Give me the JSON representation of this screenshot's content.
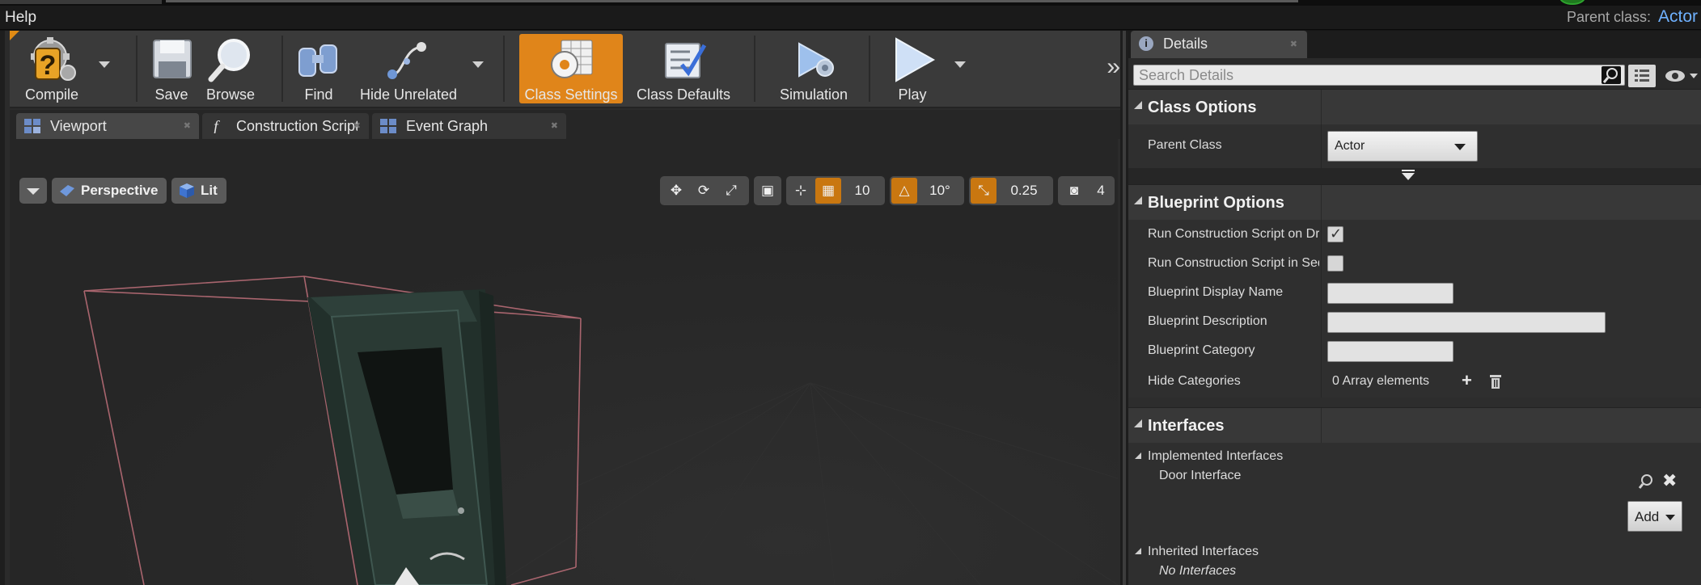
{
  "menubar": {
    "help": "Help",
    "parent_class_label": "Parent class:",
    "parent_class_value": "Actor"
  },
  "toolbar": {
    "compile": "Compile",
    "save": "Save",
    "browse": "Browse",
    "find": "Find",
    "hide_unrelated": "Hide Unrelated",
    "class_settings": "Class Settings",
    "class_defaults": "Class Defaults",
    "simulation": "Simulation",
    "play": "Play",
    "accent_color": "#e0851a"
  },
  "tabs": [
    {
      "label": "Viewport",
      "icon": "viewport-grid-icon",
      "active": true
    },
    {
      "label": "Construction Script",
      "icon": "function-icon",
      "active": false
    },
    {
      "label": "Event Graph",
      "icon": "graph-icon",
      "active": false
    }
  ],
  "viewport": {
    "view_mode": "Perspective",
    "lighting": "Lit",
    "grid_snap": "10",
    "rotation_snap": "10°",
    "scale_snap": "0.25",
    "camera_speed": "4"
  },
  "details": {
    "tab_title": "Details",
    "search_placeholder": "Search Details",
    "class_options": {
      "title": "Class Options",
      "parent_class_label": "Parent Class",
      "parent_class_value": "Actor"
    },
    "blueprint_options": {
      "title": "Blueprint Options",
      "rows": [
        {
          "label": "Run Construction Script on Drag",
          "type": "checkbox",
          "checked": true
        },
        {
          "label": "Run Construction Script in Sequencer",
          "type": "checkbox",
          "checked": false
        },
        {
          "label": "Blueprint Display Name",
          "type": "text",
          "value": ""
        },
        {
          "label": "Blueprint Description",
          "type": "text",
          "value": ""
        },
        {
          "label": "Blueprint Category",
          "type": "text",
          "value": ""
        }
      ],
      "hide_categories_label": "Hide Categories",
      "hide_categories_value": "0 Array elements"
    },
    "interfaces": {
      "title": "Interfaces",
      "implemented_label": "Implemented Interfaces",
      "implemented_items": [
        "Door Interface"
      ],
      "add_button": "Add",
      "inherited_label": "Inherited Interfaces",
      "inherited_empty": "No Interfaces"
    }
  }
}
